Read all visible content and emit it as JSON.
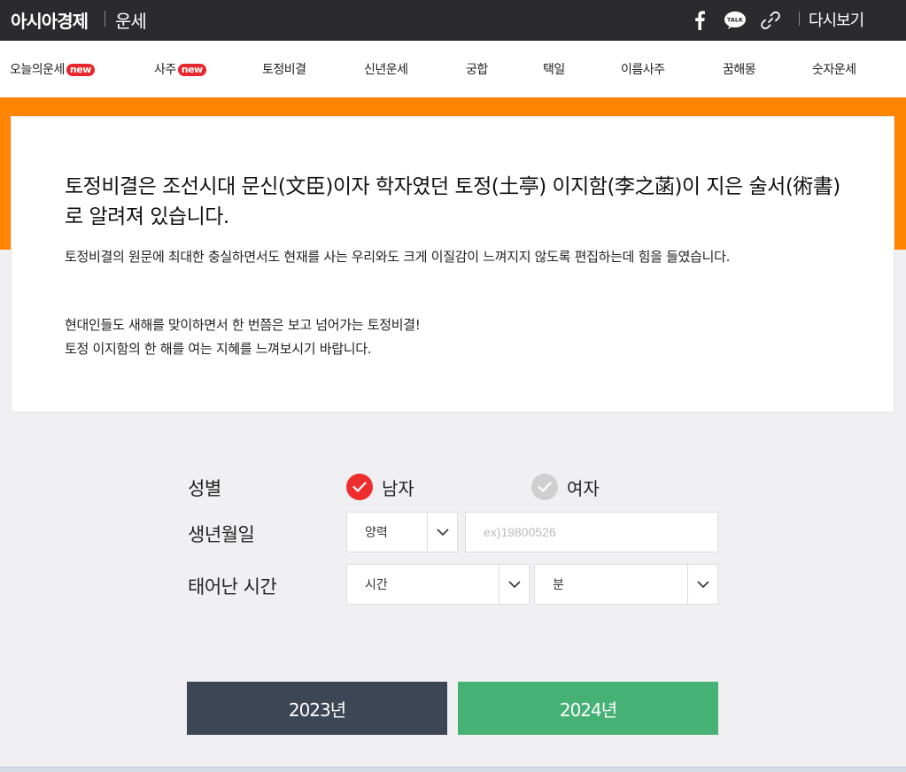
{
  "header": {
    "brand": "아시아경제",
    "section": "운세",
    "replay_label": "다시보기",
    "icons": [
      "facebook-icon",
      "kakaotalk-icon",
      "link-icon"
    ],
    "talk_text": "TALK"
  },
  "nav": {
    "items": [
      {
        "label": "오늘의운세",
        "badge": "new"
      },
      {
        "label": "사주",
        "badge": "new"
      },
      {
        "label": "토정비결"
      },
      {
        "label": "신년운세"
      },
      {
        "label": "궁합"
      },
      {
        "label": "택일"
      },
      {
        "label": "이름사주"
      },
      {
        "label": "꿈해몽"
      },
      {
        "label": "숫자운세"
      }
    ]
  },
  "intro": {
    "title": "토정비결은 조선시대 문신(文臣)이자 학자였던 토정(土亭) 이지함(李之菡)이 지은 술서(術書)로 알려져 있습니다.",
    "p1": "토정비결의 원문에 최대한 충실하면서도 현재를 사는 우리와도 크게 이질감이 느껴지지 않도록 편집하는데 힘을 들였습니다.",
    "p2_line1": "현대인들도 새해를 맞이하면서 한 번쯤은 보고 넘어가는 토정비결!",
    "p2_line2": "토정 이지함의 한 해를 여는 지혜를 느껴보시기 바랍니다."
  },
  "form": {
    "gender_label": "성별",
    "gender_male": "남자",
    "gender_female": "여자",
    "selected_gender": "남자",
    "birth_label": "생년월일",
    "calendar_value": "양력",
    "birth_placeholder": "ex)19800526",
    "time_label": "태어난 시간",
    "hour_value": "시간",
    "minute_value": "분"
  },
  "buttons": {
    "y2023": "2023년",
    "y2024": "2024년"
  },
  "colors": {
    "topbar": "#2b2b2d",
    "accent_orange": "#ff8500",
    "badge_red": "#e8262b",
    "check_red": "#ee2e2e",
    "btn_dark": "#3d4654",
    "btn_green": "#45b174"
  }
}
